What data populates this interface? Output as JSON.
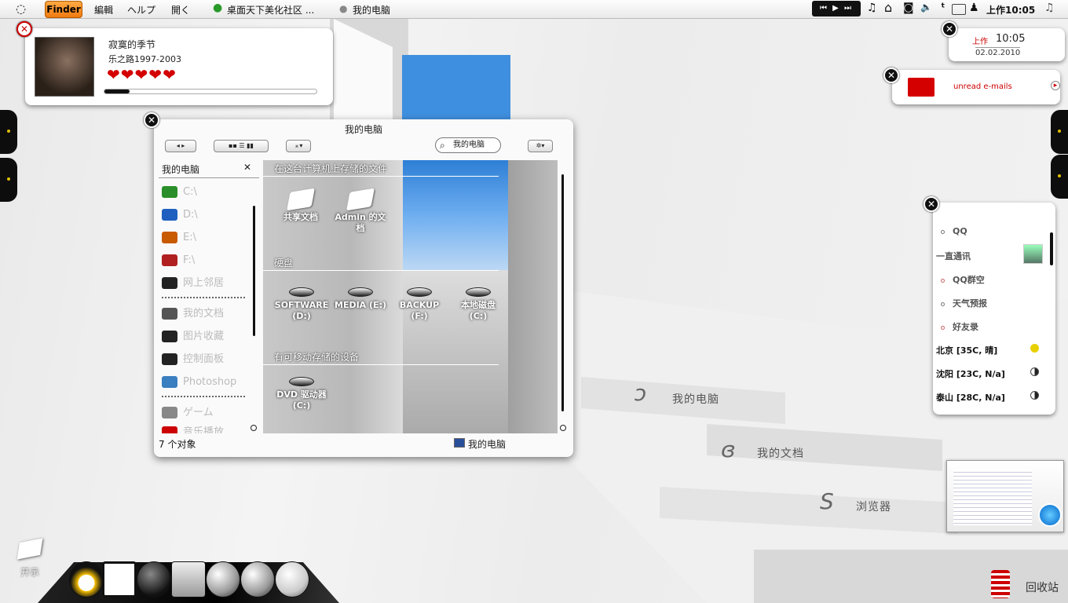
{
  "menubar": {
    "finder": "Finder",
    "edit": "編輯",
    "help": "ヘルプ",
    "open": "開く",
    "tab1": "桌面天下美化社区 ...",
    "tab2": "我的电脑",
    "clock_period": "上作",
    "clock_time": "10:05",
    "media": "⏮ ▶ ⏭",
    "music_icon": "♫",
    "home_icon": "⌂",
    "camera_icon": "◙",
    "volume_icon": "🔈",
    "t_icon": "ᵗ",
    "qq_icon": "♟",
    "note_icon": "♫"
  },
  "music": {
    "song": "寂寞的季节",
    "album": "乐之路1997-2003",
    "rating": 5,
    "progress": 0.12,
    "heart": "❤"
  },
  "clockw": {
    "period": "上作",
    "time": "10:05",
    "date": "02.02.2010"
  },
  "mail": {
    "label": "unread e-mails",
    "arrow": "▸"
  },
  "finder": {
    "title": "我的电脑",
    "search": "我的电脑",
    "nav": "◂ ▸",
    "views": "▪▪ ☰ ▮▮",
    "action": "⌅▾",
    "gear": "✲▾",
    "sidebar_title": "我的电脑",
    "sidebar_close": "✕",
    "sidebar": [
      {
        "label": "C:\\",
        "color": "#2a8f2a"
      },
      {
        "label": "D:\\",
        "color": "#1f5fbf"
      },
      {
        "label": "E:\\",
        "color": "#c85a00"
      },
      {
        "label": "F:\\",
        "color": "#b02020"
      },
      {
        "label": "网上邻居",
        "color": "#222"
      },
      {
        "label": "我的文档",
        "color": "#555"
      },
      {
        "label": "图片收藏",
        "color": "#222"
      },
      {
        "label": "控制面板",
        "color": "#222"
      },
      {
        "label": "Photoshop",
        "color": "#3a7fbf"
      },
      {
        "label": "ゲーム",
        "color": "#888"
      },
      {
        "label": "音乐播放",
        "color": "#c00"
      }
    ],
    "sections": [
      "在这台计算机上存储的文件",
      "硬盘",
      "有可移动存储的设备"
    ],
    "items": [
      {
        "label": "共享文档"
      },
      {
        "label": "Admin 的文档"
      },
      {
        "label": "SOFTWARE (D:)"
      },
      {
        "label": "MEDIA (E:)"
      },
      {
        "label": "BACKUP (F:)"
      },
      {
        "label": "本地磁盘 (C:)"
      },
      {
        "label": "DVD 驱动器 (C:)"
      }
    ],
    "status_count": "7 个对象",
    "status_loc": "我的电脑"
  },
  "rlist": {
    "items": [
      "QQ",
      "一直通讯",
      "QQ群空",
      "天气预报",
      "好友录",
      "北京 [35C, 晴]",
      "沈阳 [23C, N/a]",
      "泰山 [28C, N/a]"
    ]
  },
  "stairs": {
    "s1": "我的电脑",
    "s2": "我的文档",
    "s3": "浏览器",
    "s1_icon": "ↄ",
    "s2_icon": "ɞ",
    "s3_icon": "S"
  },
  "desktop": {
    "trash": "回收站",
    "top_left": "开示"
  },
  "close": "✕"
}
